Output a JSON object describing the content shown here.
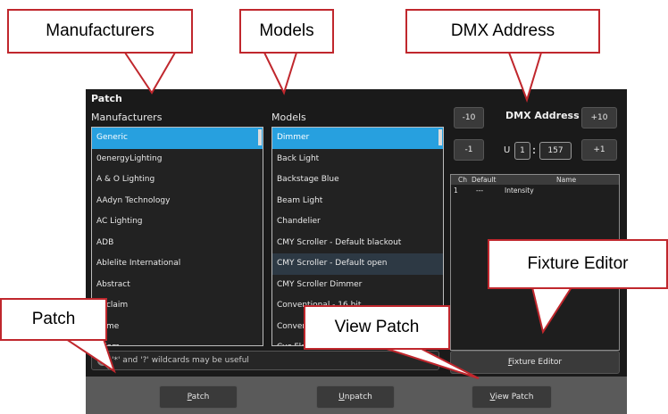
{
  "window": {
    "title": "Patch"
  },
  "manufacturers": {
    "header": "Manufacturers",
    "items": [
      {
        "label": "Generic",
        "selected": true
      },
      {
        "label": "0energyLighting"
      },
      {
        "label": "A & O Lighting"
      },
      {
        "label": "AAdyn Technology"
      },
      {
        "label": "AC Lighting"
      },
      {
        "label": "ADB"
      },
      {
        "label": "Ablelite International"
      },
      {
        "label": "Abstract"
      },
      {
        "label": "Acclaim"
      },
      {
        "label": "Acme"
      },
      {
        "label": "Adam"
      }
    ]
  },
  "models": {
    "header": "Models",
    "items": [
      {
        "label": "Dimmer",
        "selected": true
      },
      {
        "label": "Back Light"
      },
      {
        "label": "Backstage Blue"
      },
      {
        "label": "Beam Light"
      },
      {
        "label": "Chandelier"
      },
      {
        "label": "CMY Scroller - Default blackout"
      },
      {
        "label": "CMY Scroller - Default open",
        "highlighted": true
      },
      {
        "label": "CMY Scroller Dimmer"
      },
      {
        "label": "Conventional - 16 bit"
      },
      {
        "label": "Conventional"
      },
      {
        "label": "Cyc Flood"
      }
    ]
  },
  "search": {
    "hint": "'*' and '?' wildcards may be useful"
  },
  "dmx": {
    "title": "DMX Address",
    "minus10": "-10",
    "plus10": "+10",
    "minus1": "-1",
    "plus1": "+1",
    "universe_label": "U",
    "universe": "1",
    "separator": ":",
    "address": "157"
  },
  "channels": {
    "headers": {
      "ch": "Ch",
      "default": "Default",
      "name": "Name"
    },
    "rows": [
      {
        "ch": "1",
        "default": "---",
        "name": "Intensity"
      }
    ]
  },
  "buttons": {
    "fixture_editor": {
      "accel": "F",
      "rest": "ixture Editor"
    },
    "patch": {
      "accel": "P",
      "rest": "atch"
    },
    "unpatch": {
      "accel": "U",
      "rest": "npatch"
    },
    "view_patch": {
      "accel": "V",
      "rest": "iew Patch"
    }
  },
  "callouts": {
    "manufacturers": "Manufacturers",
    "models": "Models",
    "dmx_address": "DMX Address",
    "fixture_editor": "Fixture Editor",
    "patch": "Patch",
    "view_patch": "View Patch"
  },
  "colors": {
    "accent": "#27a0df",
    "callout_border": "#c0272d",
    "panel_bg": "#1a1a1a"
  }
}
